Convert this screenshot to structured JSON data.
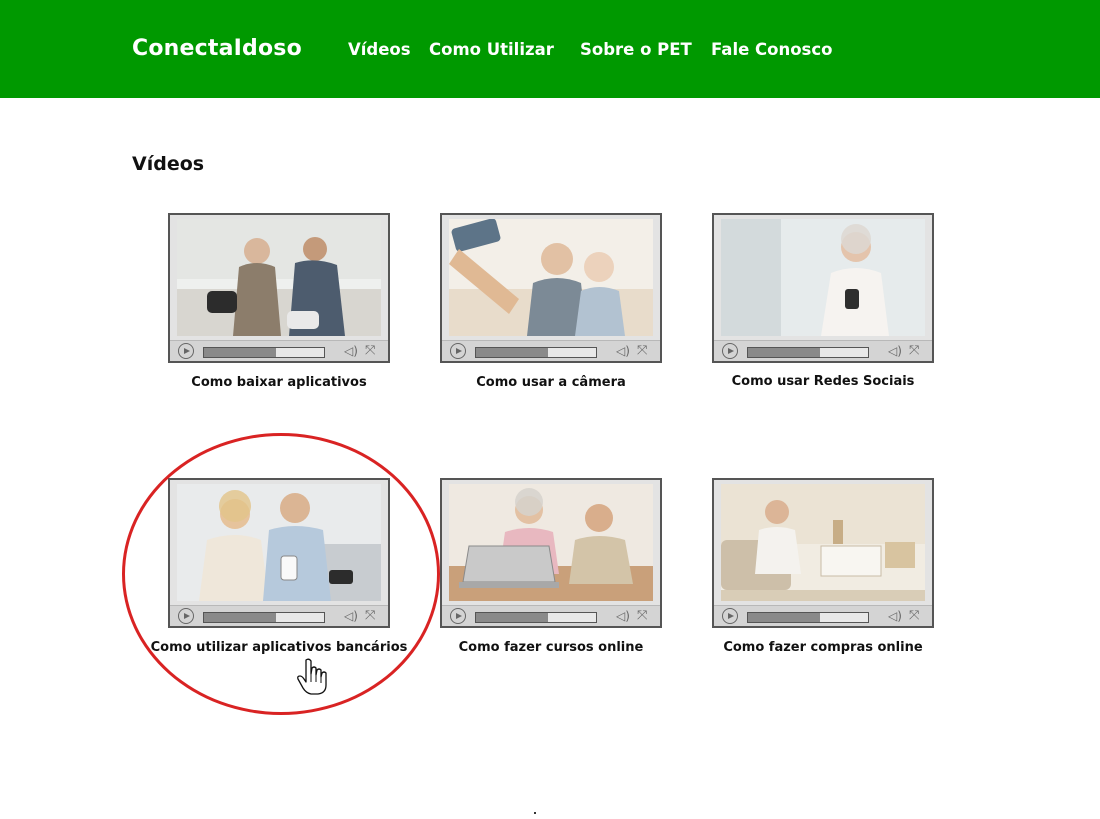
{
  "header": {
    "brand": "ConectaIdoso",
    "nav": [
      "Vídeos",
      "Como Utilizar",
      "Sobre o PET",
      "Fale Conosco"
    ],
    "color": "#009900"
  },
  "main": {
    "title": "Vídeos",
    "videos": [
      {
        "caption": "Como baixar aplicativos",
        "progress": 0.6
      },
      {
        "caption": "Como usar a câmera",
        "progress": 0.6
      },
      {
        "caption": "Como usar Redes Sociais",
        "progress": 0.6
      },
      {
        "caption": "Como utilizar aplicativos bancários",
        "progress": 0.6,
        "highlighted": true
      },
      {
        "caption": "Como fazer cursos online",
        "progress": 0.6
      },
      {
        "caption": "Como fazer compras online",
        "progress": 0.6
      }
    ]
  },
  "icons": {
    "play": "play-icon",
    "volume": "volume-icon",
    "fullscreen": "fullscreen-icon",
    "pointer": "hand-pointer-icon"
  },
  "annotation_color": "#d92323"
}
